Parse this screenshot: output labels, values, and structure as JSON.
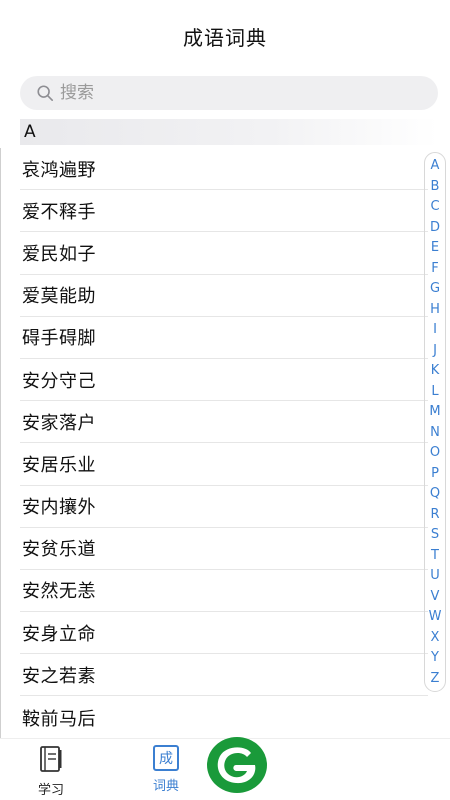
{
  "header": {
    "title": "成语词典"
  },
  "search": {
    "placeholder": "搜索"
  },
  "section": {
    "letter": "A"
  },
  "idioms": [
    "哀鸿遍野",
    "爱不释手",
    "爱民如子",
    "爱莫能助",
    "碍手碍脚",
    "安分守己",
    "安家落户",
    "安居乐业",
    "安内攘外",
    "安贫乐道",
    "安然无恙",
    "安身立命",
    "安之若素",
    "鞍前马后"
  ],
  "index_letters": [
    "A",
    "B",
    "C",
    "D",
    "E",
    "F",
    "G",
    "H",
    "I",
    "J",
    "K",
    "L",
    "M",
    "N",
    "O",
    "P",
    "Q",
    "R",
    "S",
    "T",
    "U",
    "V",
    "W",
    "X",
    "Y",
    "Z"
  ],
  "tabbar": {
    "learn_label": "学习",
    "dict_label": "词典",
    "dict_icon_char": "成"
  },
  "colors": {
    "accent": "#3b7fd1",
    "logo_green": "#1a9a3a"
  }
}
